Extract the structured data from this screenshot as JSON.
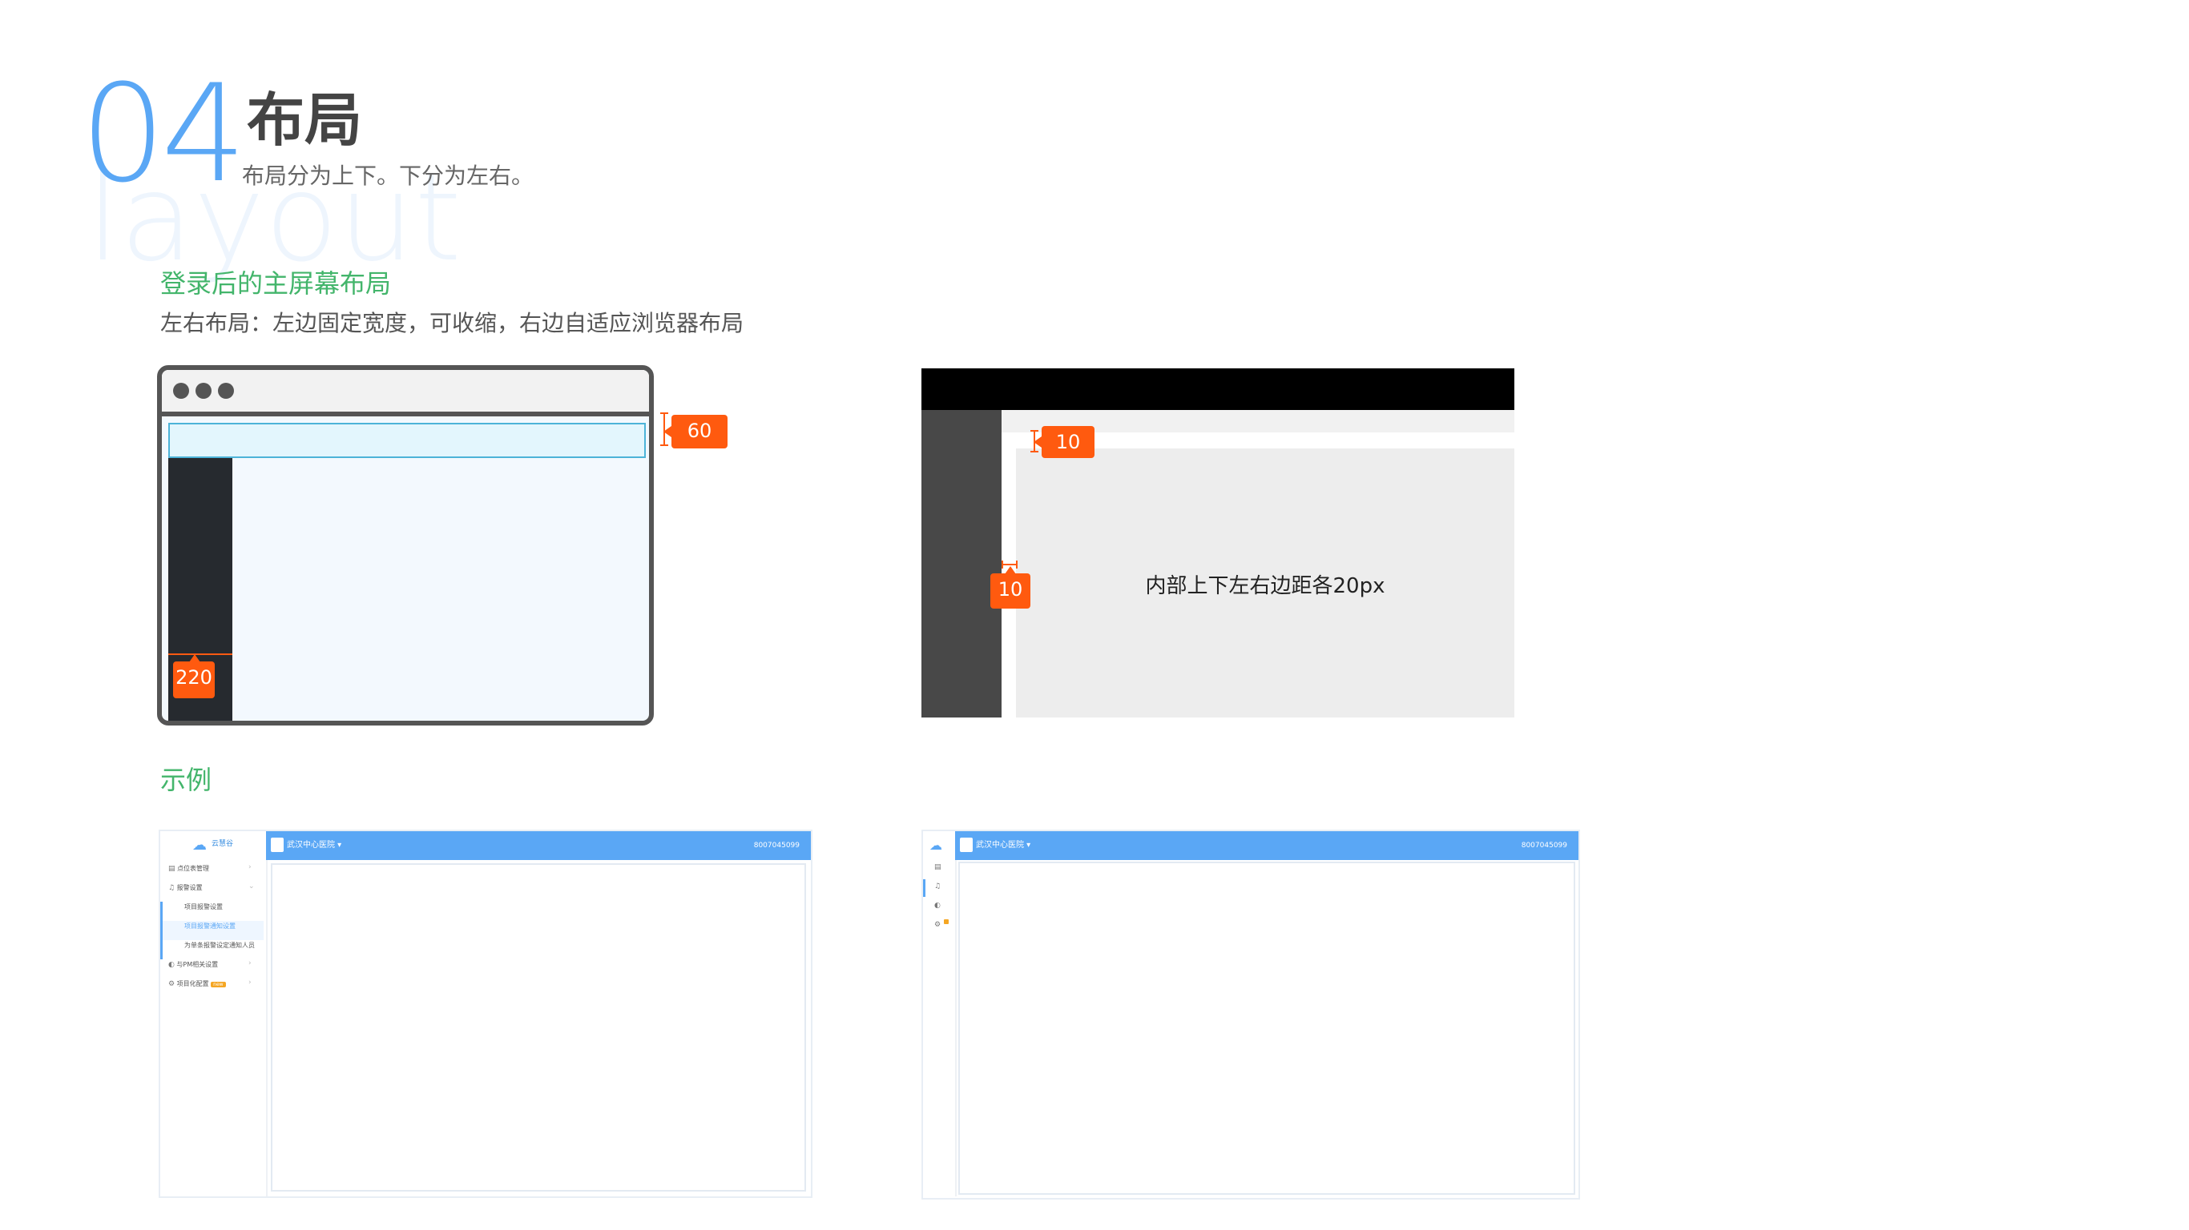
{
  "header": {
    "section_number": "04",
    "title": "布局",
    "subtitle": "布局分为上下。下分为左右。",
    "watermark": "layout"
  },
  "layout_block": {
    "heading": "登录后的主屏幕布局",
    "description": "左右布局：左边固定宽度，可收缩，右边自适应浏览器布局"
  },
  "diagram_browser": {
    "header_height_tag": "60",
    "sidebar_width_tag": "220"
  },
  "diagram_spacing": {
    "top_gap_tag": "10",
    "left_gap_tag": "10",
    "inner_text": "内部上下左右边距各20px"
  },
  "example_block": {
    "heading": "示例"
  },
  "example_app": {
    "logo_text": "云慧谷",
    "project_name": "武汉中心医院 ▾",
    "phone": "8007045099",
    "menu": {
      "item1": "点位表管理",
      "item2": "报警设置",
      "sub1": "项目报警设置",
      "sub2": "项目报警通知设置",
      "sub3": "为单条报警设定通知人员",
      "item3": "与PM相关设置",
      "item4": "项目化配置",
      "badge": "new"
    }
  },
  "colors": {
    "accent_blue": "#5aa7f5",
    "green_heading": "#43b56b",
    "tag_orange": "#ff5a0f",
    "dark_sidebar": "#262a2f"
  }
}
